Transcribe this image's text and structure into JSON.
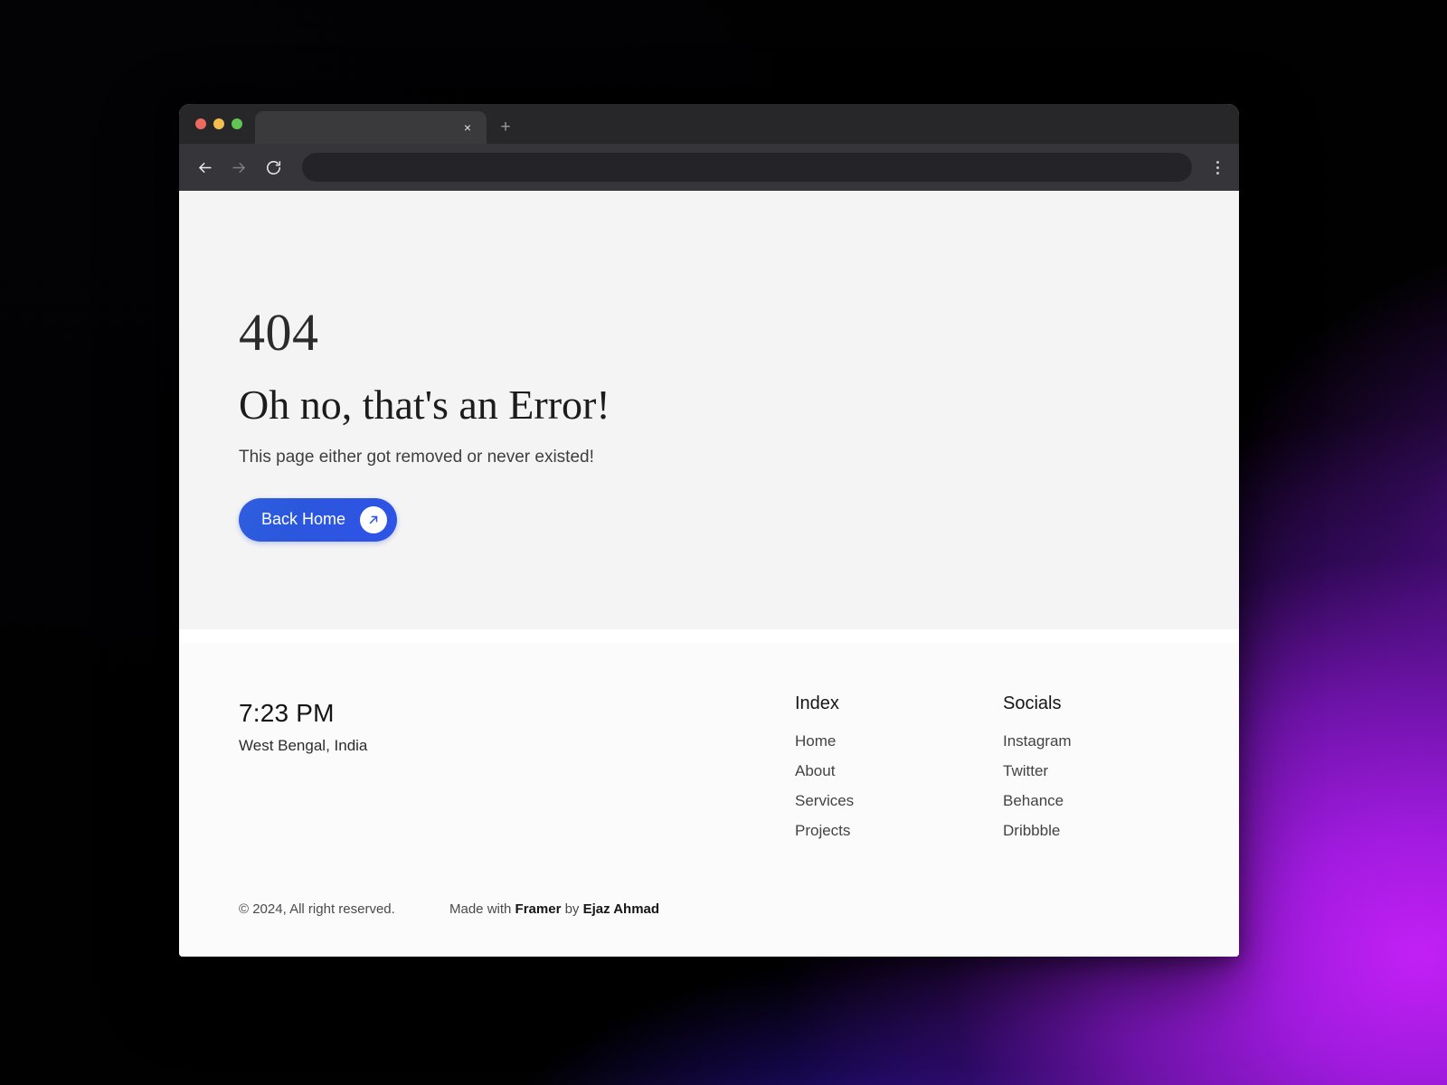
{
  "browser": {
    "traffic_lights": [
      "close",
      "minimize",
      "maximize"
    ],
    "tab": {
      "title": "",
      "close_label": "×"
    },
    "new_tab_label": "+",
    "nav": {
      "back": "back-arrow",
      "forward": "forward-arrow",
      "reload": "reload-icon"
    },
    "address_bar": {
      "value": "",
      "placeholder": ""
    },
    "menu_label": "kebab-menu"
  },
  "hero": {
    "error_code": "404",
    "title": "Oh no, that's an Error!",
    "subtitle": "This page either got removed or never existed!",
    "button": {
      "label": "Back Home",
      "icon": "arrow-up-right-icon"
    }
  },
  "footer": {
    "time": "7:23 PM",
    "location": "West Bengal, India",
    "columns": [
      {
        "title": "Index",
        "links": [
          "Home",
          "About",
          "Services",
          "Projects"
        ]
      },
      {
        "title": "Socials",
        "links": [
          "Instagram",
          "Twitter",
          "Behance",
          "Dribbble"
        ]
      }
    ],
    "copyright": "© 2024, All right reserved.",
    "credit": {
      "prefix": "Made with ",
      "tool": "Framer",
      "middle": " by ",
      "author": "Ejaz Ahmad"
    }
  },
  "colors": {
    "accent_blue": "#2f53e8",
    "hero_bg": "#f4f4f4",
    "footer_bg": "#fbfbfb",
    "chrome_tabstrip": "#272729",
    "chrome_toolbar": "#36363a",
    "backdrop_purple": "#a11ae0",
    "backdrop_blue": "#3b18f0",
    "traffic_red": "#ed6a5e",
    "traffic_yellow": "#f4bd4f",
    "traffic_green": "#61c554"
  }
}
